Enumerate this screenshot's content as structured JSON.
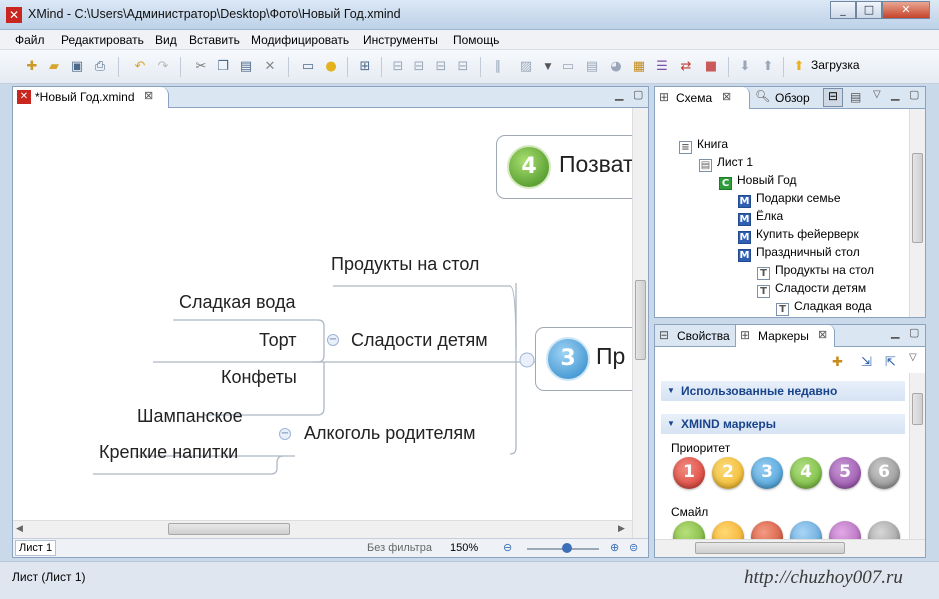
{
  "window": {
    "title": "XMind - C:\\Users\\Администратор\\Desktop\\Фото\\Новый Год.xmind",
    "controls": [
      "_",
      "□",
      "✕"
    ]
  },
  "menu": [
    "Файл",
    "Редактировать",
    "Вид",
    "Вставить",
    "Модифицировать",
    "Инструменты",
    "Помощь"
  ],
  "toolbar": {
    "download_label": "Загрузка"
  },
  "editor": {
    "tab_label": "*Новый Год.xmind",
    "topics": {
      "t4": "Позвать",
      "t3": "Пр",
      "products": "Продукты на стол",
      "sweets": "Сладости детям",
      "sweet_water": "Сладкая вода",
      "cake": "Торт",
      "candy": "Конфеты",
      "alcohol": "Алкоголь родителям",
      "champagne": "Шампанское",
      "strong": "Крепкие напитки"
    },
    "badge4": "4",
    "badge3": "3",
    "sheet_tab": "Лист 1",
    "filter_text": "Без фильтра",
    "zoom": "150%"
  },
  "outline": {
    "tabs": [
      "Схема",
      "Обзор"
    ],
    "rows": [
      {
        "label": "Книга",
        "icon": "D"
      },
      {
        "label": "Лист 1",
        "icon": "D"
      },
      {
        "label": "Новый Год",
        "icon": "C"
      },
      {
        "label": "Подарки семье",
        "icon": "M"
      },
      {
        "label": "Ёлка",
        "icon": "M"
      },
      {
        "label": "Купить фейерверк",
        "icon": "M"
      },
      {
        "label": "Праздничный стол",
        "icon": "M"
      },
      {
        "label": "Продукты на стол",
        "icon": "T"
      },
      {
        "label": "Сладости детям",
        "icon": "T"
      },
      {
        "label": "Сладкая вода",
        "icon": "T"
      }
    ]
  },
  "markers": {
    "tabs": [
      "Свойства",
      "Маркеры"
    ],
    "recent_header": "Использованные недавно",
    "xmind_header": "XMIND маркеры",
    "priority_label": "Приоритет",
    "priorities": [
      "1",
      "2",
      "3",
      "4",
      "5",
      "6"
    ],
    "priority_colors": [
      "#d9352b",
      "#f2b31b",
      "#3b9ad6",
      "#6cb52f",
      "#9446a8",
      "#8a8a8a"
    ],
    "smiley_label": "Смайл"
  },
  "status": {
    "text": "Лист (Лист 1)",
    "watermark": "http://chuzhoy007.ru"
  }
}
